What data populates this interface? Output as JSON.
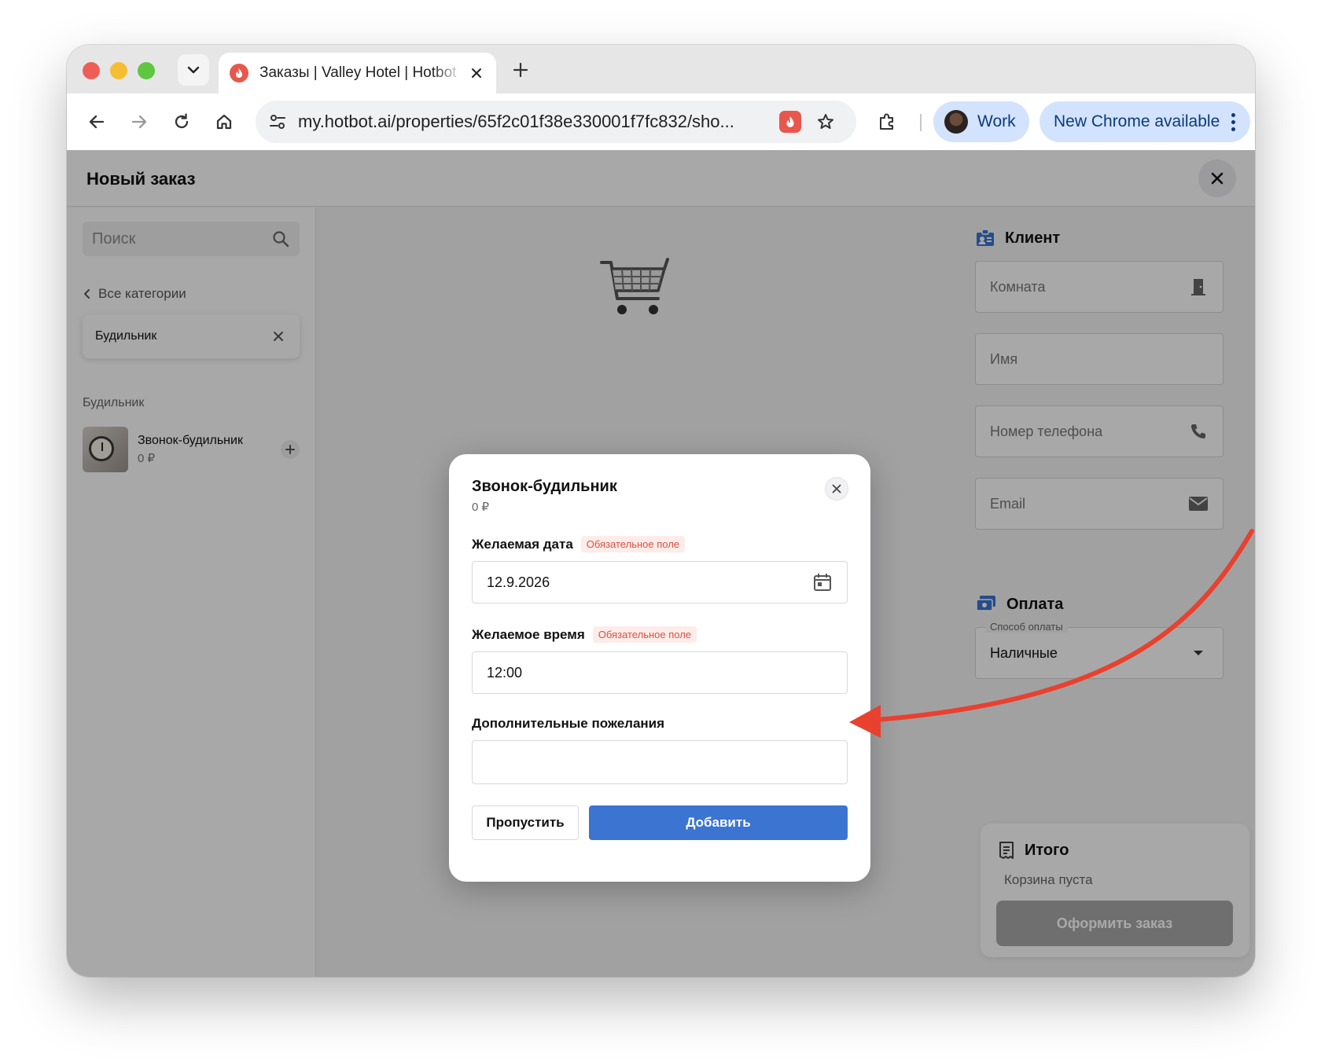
{
  "browser": {
    "tab_title": "Заказы | Valley Hotel | Hotbot",
    "url": "my.hotbot.ai/properties/65f2c01f38e330001f7fc832/sho...",
    "profile_label": "Work",
    "update_label": "New Chrome available"
  },
  "page": {
    "title": "Новый заказ"
  },
  "catalog": {
    "search_placeholder": "Поиск",
    "back_label": "Все категории",
    "selected_category": "Будильник",
    "section_label": "Будильник",
    "items": [
      {
        "name": "Звонок-будильник",
        "price": "0 ₽"
      }
    ]
  },
  "client": {
    "title": "Клиент",
    "room_placeholder": "Комната",
    "name_placeholder": "Имя",
    "phone_placeholder": "Номер телефона",
    "email_placeholder": "Email"
  },
  "payment": {
    "title": "Оплата",
    "method_label": "Способ оплаты",
    "method_value": "Наличные"
  },
  "total": {
    "title": "Итого",
    "empty_text": "Корзина пуста",
    "checkout_label": "Оформить заказ"
  },
  "modal": {
    "title": "Звонок-будильник",
    "price": "0 ₽",
    "date_label": "Желаемая дата",
    "date_value": "12.9.2026",
    "time_label": "Желаемое время",
    "time_value": "12:00",
    "required_badge": "Обязательное поле",
    "notes_label": "Дополнительные пожелания",
    "notes_value": "",
    "skip_label": "Пропустить",
    "add_label": "Добавить"
  },
  "colors": {
    "primary": "#3b74d1",
    "annotation_arrow": "#e8412f",
    "required": "#d9533f"
  }
}
